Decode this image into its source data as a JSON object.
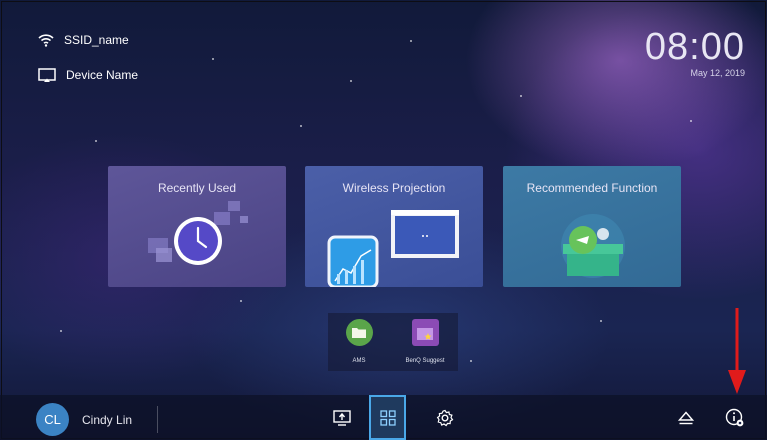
{
  "status": {
    "wifi_icon": "wifi-icon",
    "ssid": "SSID_name",
    "cast_icon": "cast-icon",
    "device_name": "Device Name"
  },
  "clock": {
    "time": "08:00",
    "date": "May 12, 2019"
  },
  "cards": [
    {
      "title": "Recently Used",
      "icon": "clock-icon"
    },
    {
      "title": "Wireless Projection",
      "icon": "phone-screen-icon"
    },
    {
      "title": "Recommended Function",
      "icon": "gift-box-icon"
    }
  ],
  "apps": [
    {
      "label": "AMS",
      "icon": "folder-icon",
      "color": "#5aa54a"
    },
    {
      "label": "BenQ Suggest",
      "icon": "shopping-bag-star-icon",
      "color": "#8b4bb5"
    }
  ],
  "taskbar": {
    "avatar_initials": "CL",
    "user_name": "Cindy Lin",
    "buttons": [
      "input-source-icon",
      "apps-grid-icon",
      "settings-gear-icon",
      "eject-icon",
      "info-settings-icon"
    ],
    "active_button": "apps-grid-icon"
  },
  "annotation": {
    "icon": "red-down-arrow-icon",
    "color": "#e01b1b"
  },
  "colors": {
    "accent": "#4aa8e8",
    "avatar": "#3b83c4"
  }
}
